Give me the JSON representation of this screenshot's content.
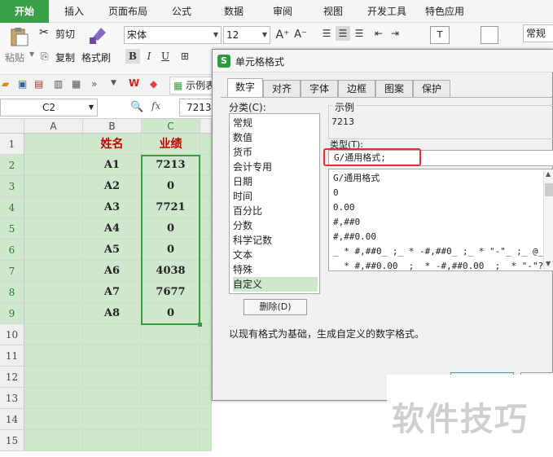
{
  "menubar": {
    "tabs": [
      "开始",
      "插入",
      "页面布局",
      "公式",
      "数据",
      "审阅",
      "视图",
      "开发工具",
      "特色应用"
    ]
  },
  "ribbon": {
    "paste": "粘贴",
    "cut": "剪切",
    "copy": "复制",
    "format_painter": "格式刷",
    "font_name": "宋体",
    "font_size": "12",
    "bold": "B",
    "italic": "I",
    "underline": "U",
    "number_format": "常规"
  },
  "qat": {
    "doc_tab": "示例表"
  },
  "formula_bar": {
    "name_box": "C2",
    "fx": "fx",
    "value": "7213"
  },
  "sheet": {
    "columns": [
      "A",
      "B",
      "C"
    ],
    "rows": [
      "1",
      "2",
      "3",
      "4",
      "5",
      "6",
      "7",
      "8",
      "9",
      "10",
      "11",
      "12",
      "13",
      "14",
      "15"
    ],
    "header": {
      "name": "姓名",
      "score": "业绩"
    },
    "data": [
      {
        "name": "A1",
        "score": "7213"
      },
      {
        "name": "A2",
        "score": "0"
      },
      {
        "name": "A3",
        "score": "7721"
      },
      {
        "name": "A4",
        "score": "0"
      },
      {
        "name": "A5",
        "score": "0"
      },
      {
        "name": "A6",
        "score": "4038"
      },
      {
        "name": "A7",
        "score": "7677"
      },
      {
        "name": "A8",
        "score": "0"
      }
    ]
  },
  "dialog": {
    "title": "单元格格式",
    "tabs": [
      "数字",
      "对齐",
      "字体",
      "边框",
      "图案",
      "保护"
    ],
    "category_label": "分类(C):",
    "categories": [
      "常规",
      "数值",
      "货币",
      "会计专用",
      "日期",
      "时间",
      "百分比",
      "分数",
      "科学记数",
      "文本",
      "特殊",
      "自定义"
    ],
    "sample_label": "示例",
    "sample_value": "7213",
    "type_label": "类型(T):",
    "type_value": "G/通用格式;",
    "formats": [
      "G/通用格式",
      "0",
      "0.00",
      "#,##0",
      "#,##0.00",
      "_ * #,##0_ ;_ * -#,##0_ ;_ * \"-\"_ ;_ @_",
      "_ * #,##0.00_ ;_ * -#,##0.00_ ;_ * \"-\"??…"
    ],
    "delete_button": "删除(D)",
    "description": "以现有格式为基础，生成自定义的数字格式。"
  },
  "watermark": "软件技巧",
  "colors": {
    "accent": "#3aa047",
    "header_red": "#c00000",
    "selection_green": "#cfe7cc",
    "highlight_box": "#e03030"
  }
}
